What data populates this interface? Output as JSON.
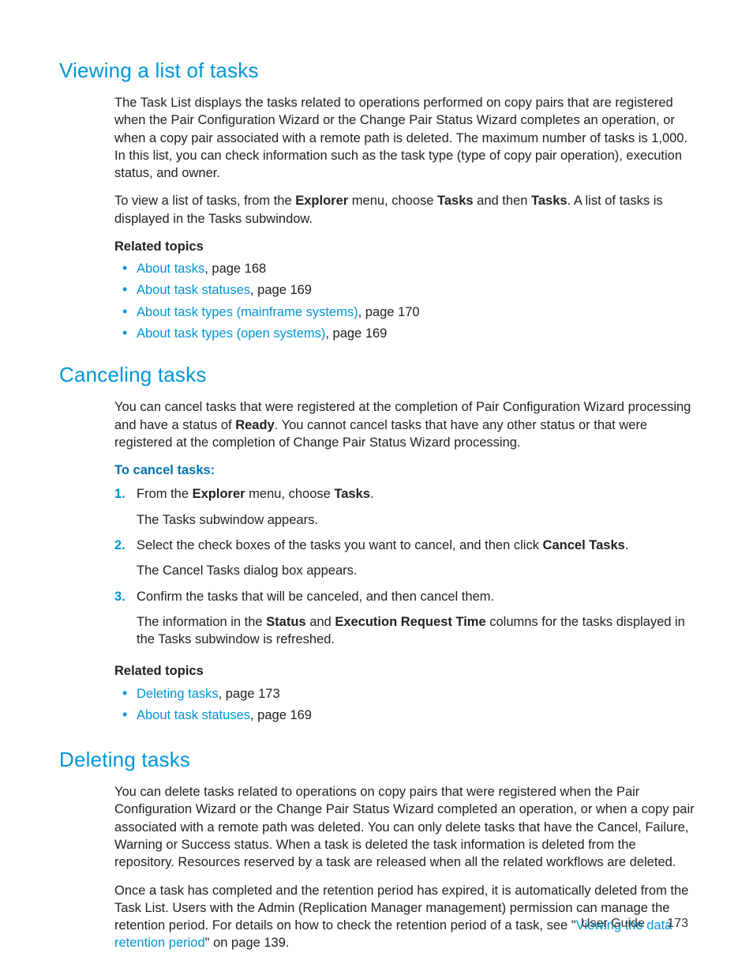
{
  "section1": {
    "title": "Viewing a list of tasks",
    "para1": "The Task List displays the tasks related to operations performed on copy pairs that are registered when the Pair Configuration Wizard or the Change Pair Status Wizard completes an operation, or when a copy pair associated with a remote path is deleted. The maximum number of tasks is 1,000.  In this list, you can check information such as the task type (type of copy pair operation), execution status, and owner.",
    "para2_a": "To view a list of tasks, from the ",
    "para2_b": "Explorer",
    "para2_c": " menu, choose ",
    "para2_d": "Tasks",
    "para2_e": " and then ",
    "para2_f": "Tasks",
    "para2_g": ". A list of tasks is displayed in the Tasks subwindow.",
    "related_label": "Related topics",
    "links": [
      {
        "text": "About tasks",
        "suffix": ", page 168"
      },
      {
        "text": "About task statuses",
        "suffix": ", page 169"
      },
      {
        "text": "About task types (mainframe systems)",
        "suffix": ", page 170"
      },
      {
        "text": "About task types (open systems)",
        "suffix": ", page 169"
      }
    ]
  },
  "section2": {
    "title": "Canceling tasks",
    "para1_a": "You can cancel tasks that were registered at the completion of Pair Configuration Wizard processing and have a status of ",
    "para1_b": "Ready",
    "para1_c": ". You cannot cancel tasks that have any other status or that were registered at the completion of Change Pair Status Wizard processing.",
    "proc_label": "To cancel tasks:",
    "step1_a": "From the ",
    "step1_b": "Explorer",
    "step1_c": " menu, choose ",
    "step1_d": "Tasks",
    "step1_e": ".",
    "step1_sub": "The Tasks subwindow appears.",
    "step2_a": "Select the check boxes of the tasks you want to cancel, and then click ",
    "step2_b": "Cancel Tasks",
    "step2_c": ".",
    "step2_sub": "The Cancel Tasks dialog box appears.",
    "step3_a": "Confirm the tasks that will be canceled, and then cancel them.",
    "step3_sub_a": "The information in the ",
    "step3_sub_b": "Status",
    "step3_sub_c": " and ",
    "step3_sub_d": "Execution Request Time",
    "step3_sub_e": " columns for the tasks displayed in the Tasks subwindow is refreshed.",
    "related_label": "Related topics",
    "links": [
      {
        "text": "Deleting tasks",
        "suffix": ", page 173"
      },
      {
        "text": "About task statuses",
        "suffix": ", page 169"
      }
    ]
  },
  "section3": {
    "title": "Deleting tasks",
    "para1": "You can delete tasks related to operations on copy pairs that were registered when the Pair Configuration Wizard or the Change Pair Status Wizard completed an operation, or when a copy pair associated with a remote path was deleted. You can only delete tasks that have the Cancel, Failure, Warning or Success status. When a task is deleted the task information is deleted from the repository. Resources reserved by a task are released when all the related workflows are deleted.",
    "para2_a": "Once a task has completed and the retention period has expired, it is automatically deleted from the Task List. Users with the Admin (Replication Manager management) permission can manage the retention period. For details on how to check the retention period of a task, see \"",
    "para2_link": "Viewing the data retention period",
    "para2_b": "\" on page 139."
  },
  "footer": {
    "label": "User Guide",
    "page": "173"
  }
}
